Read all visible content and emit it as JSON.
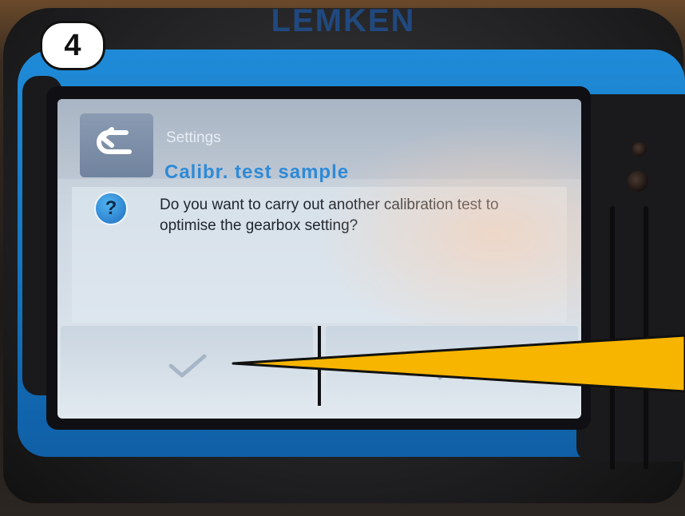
{
  "badge": {
    "step_number": "4"
  },
  "device": {
    "brand": "LEMKEN"
  },
  "screen": {
    "header": {
      "breadcrumb": "Settings",
      "title": "Calibr. test sample"
    },
    "dialog": {
      "icon": "question-icon",
      "message": "Do you want to carry out another calibration test to optimise the gearbox setting?"
    },
    "buttons": {
      "confirm_icon": "checkmark-icon",
      "cancel_icon": "close-icon"
    }
  },
  "colors": {
    "device_blue": "#1677c2",
    "title_blue": "#2e8ad6",
    "pointer_yellow": "#f7b500"
  }
}
